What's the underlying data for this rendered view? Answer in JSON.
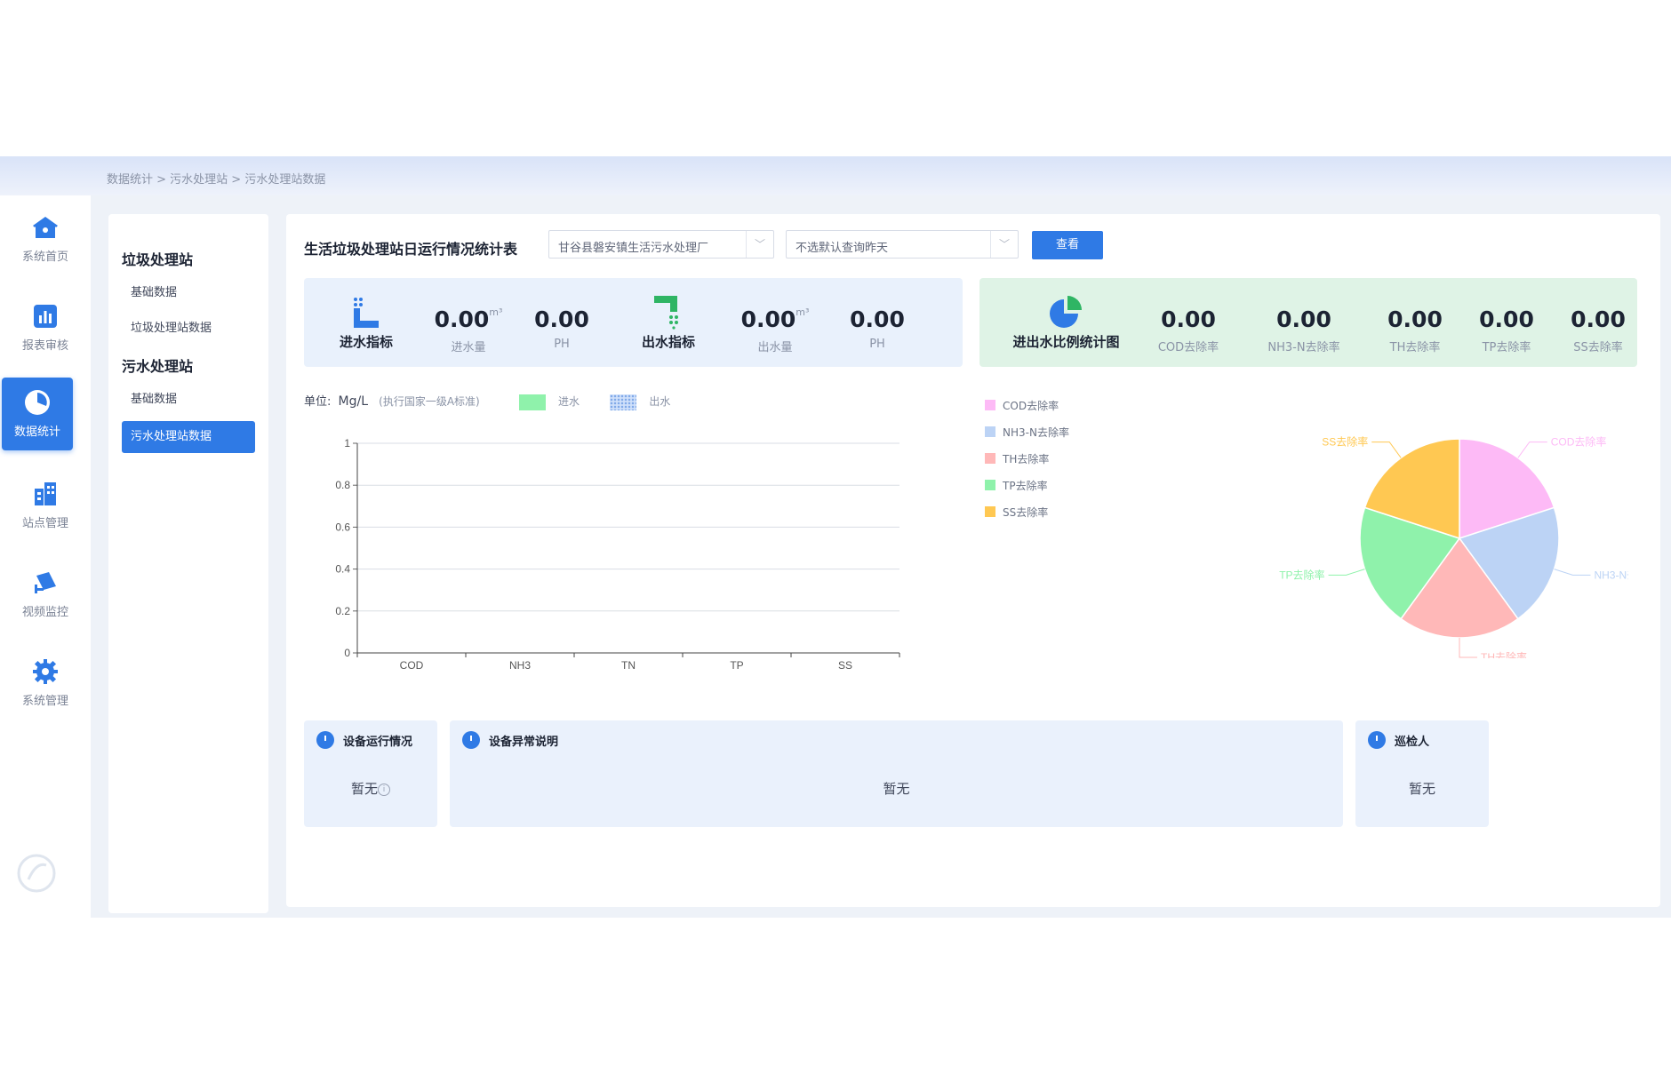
{
  "breadcrumb": "数据统计 > 污水处理站 > 污水处理站数据",
  "sidebar": {
    "items": [
      {
        "label": "系统首页",
        "icon": "home-icon"
      },
      {
        "label": "报表审核",
        "icon": "bar-chart-icon"
      },
      {
        "label": "数据统计",
        "icon": "pie-chart-icon",
        "active": true
      },
      {
        "label": "站点管理",
        "icon": "building-icon"
      },
      {
        "label": "视频监控",
        "icon": "camera-icon"
      },
      {
        "label": "系统管理",
        "icon": "gear-icon"
      }
    ]
  },
  "sublist": {
    "groups": [
      {
        "title": "垃圾处理站",
        "items": [
          "基础数据",
          "垃圾处理站数据"
        ]
      },
      {
        "title": "污水处理站",
        "items": [
          "基础数据",
          "污水处理站数据"
        ]
      }
    ],
    "active": "污水处理站数据"
  },
  "main": {
    "title": "生活垃圾处理站日运行情况统计表",
    "station_select": "甘谷县磐安镇生活污水处理厂",
    "date_select_placeholder": "不选默认查询昨天",
    "query_button": "查看"
  },
  "inflow": {
    "label": "进水指标",
    "volume": {
      "value": "0.00",
      "unit": "m³",
      "caption": "进水量"
    },
    "ph": {
      "value": "0.00",
      "caption": "PH"
    }
  },
  "outflow": {
    "label": "出水指标",
    "volume": {
      "value": "0.00",
      "unit": "m³",
      "caption": "出水量"
    },
    "ph": {
      "value": "0.00",
      "caption": "PH"
    }
  },
  "ratio": {
    "label": "进出水比例统计图",
    "items": [
      {
        "value": "0.00",
        "caption": "COD去除率"
      },
      {
        "value": "0.00",
        "caption": "NH3-N去除率"
      },
      {
        "value": "0.00",
        "caption": "TH去除率"
      },
      {
        "value": "0.00",
        "caption": "TP去除率"
      },
      {
        "value": "0.00",
        "caption": "SS去除率"
      }
    ]
  },
  "bar_legend": {
    "unit_label": "单位:",
    "unit": "Mg/L",
    "standard": "(执行国家一级A标准)",
    "in_label": "进水",
    "out_label": "出水"
  },
  "chart_data": [
    {
      "type": "bar",
      "categories": [
        "COD",
        "NH3",
        "TN",
        "TP",
        "SS"
      ],
      "series": [
        {
          "name": "进水",
          "values": [
            0,
            0,
            0,
            0,
            0
          ],
          "color": "#8ff2ab"
        },
        {
          "name": "出水",
          "values": [
            0,
            0,
            0,
            0,
            0
          ],
          "color": "#bcd3f5"
        }
      ],
      "ylim": [
        0,
        1
      ],
      "yticks": [
        "0",
        "0.2",
        "0.4",
        "0.6",
        "0.8",
        "1"
      ],
      "grid": true
    },
    {
      "type": "pie",
      "labels": [
        "COD去除率",
        "NH3-N去除率",
        "TH去除率",
        "TP去除率",
        "SS去除率"
      ],
      "values": [
        1,
        1,
        1,
        1,
        1
      ],
      "colors": [
        "#fdbaf6",
        "#bcd3f5",
        "#ffb8b8",
        "#8ff2ab",
        "#ffc852"
      ],
      "legend": "left"
    }
  ],
  "cards": [
    {
      "title": "设备运行情况",
      "body": "暂无",
      "info_icon": "info-icon"
    },
    {
      "title": "设备异常说明",
      "body": "暂无"
    },
    {
      "title": "巡检人",
      "body": "暂无"
    }
  ]
}
